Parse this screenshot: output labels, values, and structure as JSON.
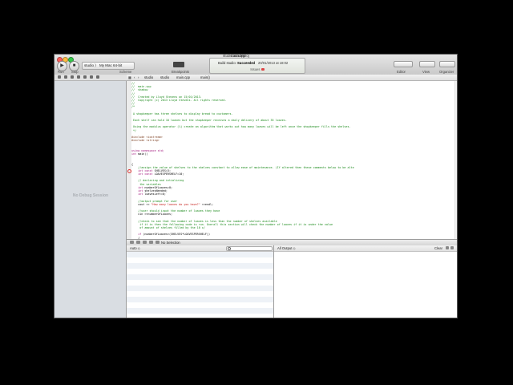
{
  "window": {
    "title": "main.cpp"
  },
  "toolbar": {
    "run_label": "Run",
    "stop_label": "Stop",
    "run_icon": "play-icon",
    "stop_icon": "stop-icon",
    "scheme_text": "studio  〉 My Mac 64-bit",
    "scheme_label": "Scheme",
    "breakpoints_label": "Breakpoints",
    "status_project": "studio.xcodeproj",
    "status_file": "main.cpp",
    "status_prefix": "Build studio: ",
    "status_result": "Succeeded",
    "status_time": "20/01/2013 at 18:02",
    "status_issues": "Issues",
    "editor_label": "Editor",
    "view_label": "View",
    "organizer_label": "Organizer"
  },
  "jumpbar": {
    "items": [
      "studio",
      "studio",
      "main.cpp",
      "main()"
    ]
  },
  "navigator": {
    "empty_text": "No Debug Session"
  },
  "code_lines": [
    [
      {
        "c": "com",
        "t": "//"
      }
    ],
    [
      {
        "c": "com",
        "t": "//  main.cpp"
      }
    ],
    [
      {
        "c": "com",
        "t": "//  shadow"
      }
    ],
    [
      {
        "c": "com",
        "t": "//"
      }
    ],
    [
      {
        "c": "com",
        "t": "//  Created by Lloyd Stevens on 15/01/2013."
      }
    ],
    [
      {
        "c": "com",
        "t": "//  Copyright (c) 2013 Lloyd Stevens. All rights reserved."
      }
    ],
    [
      {
        "c": "com",
        "t": "//"
      }
    ],
    [
      {
        "c": "com",
        "t": "/*"
      }
    ],
    [
      {
        "c": "com",
        "t": ""
      }
    ],
    [
      {
        "c": "com",
        "t": " A shopkeeper has three shelves to display bread to customers."
      }
    ],
    [
      {
        "c": "com",
        "t": ""
      }
    ],
    [
      {
        "c": "com",
        "t": " Each shelf can hold 10 loaves but the shopkeeper receives a daily delivery of about 35 loaves."
      }
    ],
    [
      {
        "c": "com",
        "t": ""
      }
    ],
    [
      {
        "c": "com",
        "t": " Using the modulus operator (%) create an algorithm that works out how many loaves will be left once the shopkeeper fills the shelves."
      }
    ],
    [
      {
        "c": "com",
        "t": " */"
      }
    ],
    [
      {
        "c": "com",
        "t": ""
      }
    ],
    [
      {
        "c": "pre",
        "t": "#include <iostream>"
      }
    ],
    [
      {
        "c": "pre",
        "t": "#include <string>"
      }
    ],
    [
      {
        "c": "pl",
        "t": ""
      }
    ],
    [
      {
        "c": "pl",
        "t": ""
      }
    ],
    [
      {
        "c": "kw",
        "t": "using namespace std;"
      }
    ],
    [
      {
        "c": "kw",
        "t": "int"
      },
      {
        "c": "pl",
        "t": " main()"
      }
    ],
    [
      {
        "c": "pl",
        "t": ""
      }
    ],
    [
      {
        "c": "pl",
        "t": ""
      }
    ],
    [
      {
        "c": "pl",
        "t": "{"
      }
    ],
    [
      {
        "c": "com",
        "t": "    //assign the value of shelves to the shelves constant to allow ease of maintenance. (If altered then these comments below to be alte"
      }
    ],
    [
      {
        "c": "kw",
        "t": "    int const"
      },
      {
        "c": "pl",
        "t": " SHELVES=3;"
      }
    ],
    [
      {
        "c": "kw",
        "t": "    int const"
      },
      {
        "c": "pl",
        "t": " LOAVESPERSHELF=10;"
      }
    ],
    [
      {
        "c": "pl",
        "t": ""
      }
    ],
    [
      {
        "c": "com",
        "t": "    // declaring and intializing"
      }
    ],
    [
      {
        "c": "com",
        "t": "     the variables"
      }
    ],
    [
      {
        "c": "kw",
        "t": "    int"
      },
      {
        "c": "pl",
        "t": " numberOfLoaves=0;"
      }
    ],
    [
      {
        "c": "kw",
        "t": "    int"
      },
      {
        "c": "pl",
        "t": " shelvesNeeded;"
      }
    ],
    [
      {
        "c": "kw",
        "t": "    int"
      },
      {
        "c": "pl",
        "t": " loavesLeft=0;"
      }
    ],
    [
      {
        "c": "pl",
        "t": ""
      }
    ],
    [
      {
        "c": "com",
        "t": "    //output prompt for user"
      }
    ],
    [
      {
        "c": "pl",
        "t": "    cout << "
      },
      {
        "c": "str",
        "t": "\"How many loaves do you have?\""
      },
      {
        "c": "pl",
        "t": " <<endl;"
      }
    ],
    [
      {
        "c": "pl",
        "t": ""
      }
    ],
    [
      {
        "c": "com",
        "t": "    //user should input the number of loaves they have"
      }
    ],
    [
      {
        "c": "pl",
        "t": "    cin >>numberOfLoaves;"
      }
    ],
    [
      {
        "c": "pl",
        "t": ""
      }
    ],
    [
      {
        "c": "com",
        "t": "    //check to see that the number of loaves is less than the number of shelves available"
      }
    ],
    [
      {
        "c": "com",
        "t": "     if it is then the following code is run. Overall this section will check the number of loaves if it is under the value"
      }
    ],
    [
      {
        "c": "com",
        "t": "     of amount of shelves filled by the 10 x/"
      }
    ],
    [
      {
        "c": "pl",
        "t": ""
      }
    ],
    [
      {
        "c": "kw",
        "t": "    if"
      },
      {
        "c": "pl",
        "t": " (numberOfLoaves<(SHELVES*LOAVESPERSHELF))"
      }
    ],
    [
      {
        "c": "pl",
        "t": "    {"
      }
    ]
  ],
  "debugbar": {
    "no_selection": "No Selection"
  },
  "variables": {
    "scope": "Auto ◇"
  },
  "console": {
    "scope": "All Output ◇",
    "clear_label": "Clear"
  }
}
